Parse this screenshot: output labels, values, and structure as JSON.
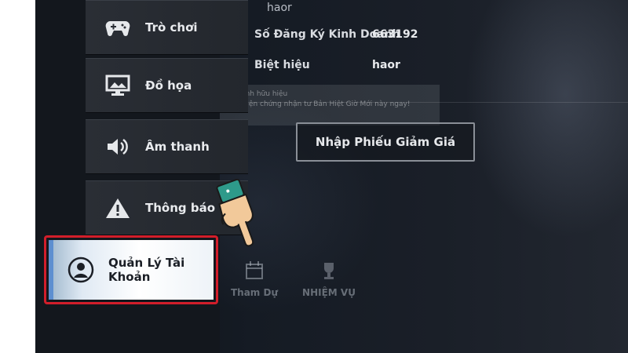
{
  "sidebar": {
    "items": [
      {
        "label": "Trò chơi",
        "icon": "gamepad-icon"
      },
      {
        "label": "Đồ họa",
        "icon": "monitor-icon"
      },
      {
        "label": "Âm thanh",
        "icon": "speaker-icon"
      },
      {
        "label": "Thông báo",
        "icon": "warning-icon"
      },
      {
        "label": "Quản Lý Tài Khoản",
        "icon": "user-icon",
        "active": true
      }
    ]
  },
  "account": {
    "name": "haor",
    "business_reg_label": "Số Đăng Ký Kinh Doanh",
    "business_reg_value": "663192",
    "nickname_label": "Biệt hiệu",
    "nickname_value": "haor"
  },
  "tooltip": {
    "line1": "Chỉ danh hữu hiệu",
    "line2": "Thực hiện chứng nhận tư Bản Hiệt Giờ Mới này ngay!"
  },
  "coupon_button": {
    "label": "Nhập Phiếu Giảm Giá"
  },
  "bottom_tabs": [
    {
      "label": "Tham Dự",
      "icon": "calendar-icon"
    },
    {
      "label": "NHIỆM VỤ",
      "icon": "trophy-icon"
    }
  ],
  "colors": {
    "highlight": "#d21e2a",
    "active_accent": "#5d8fd0"
  }
}
